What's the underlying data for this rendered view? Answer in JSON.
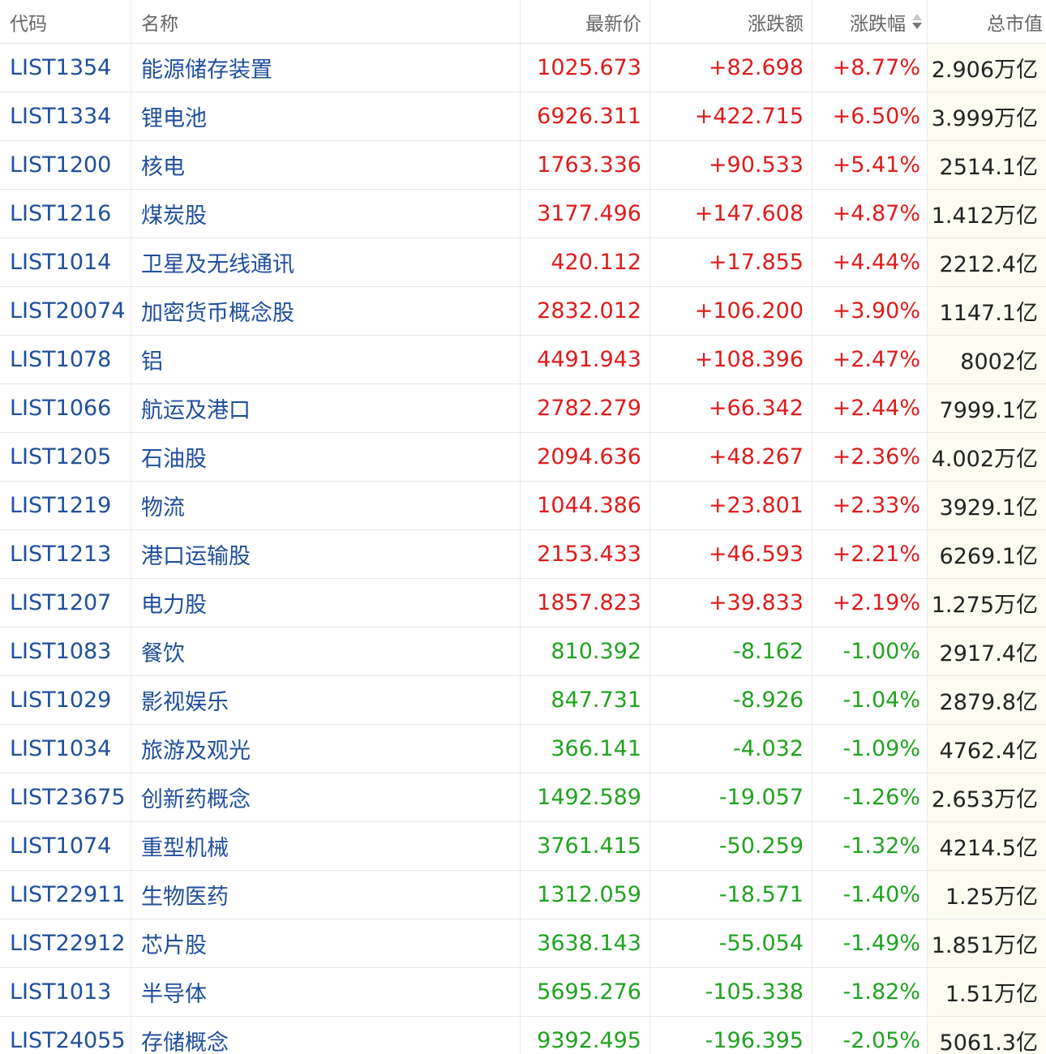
{
  "header": {
    "code": "代码",
    "name": "名称",
    "price": "最新价",
    "change": "涨跌额",
    "pct": "涨跌幅",
    "cap": "总市值"
  },
  "colors": {
    "up": "#e01b1b",
    "down": "#1fa31f",
    "link": "#1f4f9c"
  },
  "rows": [
    {
      "code": "LIST1354",
      "name": "能源储存装置",
      "price": "1025.673",
      "change": "+82.698",
      "pct": "+8.77%",
      "cap": "2.906万亿",
      "dir": "up"
    },
    {
      "code": "LIST1334",
      "name": "锂电池",
      "price": "6926.311",
      "change": "+422.715",
      "pct": "+6.50%",
      "cap": "3.999万亿",
      "dir": "up"
    },
    {
      "code": "LIST1200",
      "name": "核电",
      "price": "1763.336",
      "change": "+90.533",
      "pct": "+5.41%",
      "cap": "2514.1亿",
      "dir": "up"
    },
    {
      "code": "LIST1216",
      "name": "煤炭股",
      "price": "3177.496",
      "change": "+147.608",
      "pct": "+4.87%",
      "cap": "1.412万亿",
      "dir": "up"
    },
    {
      "code": "LIST1014",
      "name": "卫星及无线通讯",
      "price": "420.112",
      "change": "+17.855",
      "pct": "+4.44%",
      "cap": "2212.4亿",
      "dir": "up"
    },
    {
      "code": "LIST20074",
      "name": "加密货币概念股",
      "price": "2832.012",
      "change": "+106.200",
      "pct": "+3.90%",
      "cap": "1147.1亿",
      "dir": "up"
    },
    {
      "code": "LIST1078",
      "name": "铝",
      "price": "4491.943",
      "change": "+108.396",
      "pct": "+2.47%",
      "cap": "8002亿",
      "dir": "up"
    },
    {
      "code": "LIST1066",
      "name": "航运及港口",
      "price": "2782.279",
      "change": "+66.342",
      "pct": "+2.44%",
      "cap": "7999.1亿",
      "dir": "up"
    },
    {
      "code": "LIST1205",
      "name": "石油股",
      "price": "2094.636",
      "change": "+48.267",
      "pct": "+2.36%",
      "cap": "4.002万亿",
      "dir": "up"
    },
    {
      "code": "LIST1219",
      "name": "物流",
      "price": "1044.386",
      "change": "+23.801",
      "pct": "+2.33%",
      "cap": "3929.1亿",
      "dir": "up"
    },
    {
      "code": "LIST1213",
      "name": "港口运输股",
      "price": "2153.433",
      "change": "+46.593",
      "pct": "+2.21%",
      "cap": "6269.1亿",
      "dir": "up"
    },
    {
      "code": "LIST1207",
      "name": "电力股",
      "price": "1857.823",
      "change": "+39.833",
      "pct": "+2.19%",
      "cap": "1.275万亿",
      "dir": "up"
    },
    {
      "code": "LIST1083",
      "name": "餐饮",
      "price": "810.392",
      "change": "-8.162",
      "pct": "-1.00%",
      "cap": "2917.4亿",
      "dir": "down"
    },
    {
      "code": "LIST1029",
      "name": "影视娱乐",
      "price": "847.731",
      "change": "-8.926",
      "pct": "-1.04%",
      "cap": "2879.8亿",
      "dir": "down"
    },
    {
      "code": "LIST1034",
      "name": "旅游及观光",
      "price": "366.141",
      "change": "-4.032",
      "pct": "-1.09%",
      "cap": "4762.4亿",
      "dir": "down"
    },
    {
      "code": "LIST23675",
      "name": "创新药概念",
      "price": "1492.589",
      "change": "-19.057",
      "pct": "-1.26%",
      "cap": "2.653万亿",
      "dir": "down"
    },
    {
      "code": "LIST1074",
      "name": "重型机械",
      "price": "3761.415",
      "change": "-50.259",
      "pct": "-1.32%",
      "cap": "4214.5亿",
      "dir": "down"
    },
    {
      "code": "LIST22911",
      "name": "生物医药",
      "price": "1312.059",
      "change": "-18.571",
      "pct": "-1.40%",
      "cap": "1.25万亿",
      "dir": "down"
    },
    {
      "code": "LIST22912",
      "name": "芯片股",
      "price": "3638.143",
      "change": "-55.054",
      "pct": "-1.49%",
      "cap": "1.851万亿",
      "dir": "down"
    },
    {
      "code": "LIST1013",
      "name": "半导体",
      "price": "5695.276",
      "change": "-105.338",
      "pct": "-1.82%",
      "cap": "1.51万亿",
      "dir": "down"
    },
    {
      "code": "LIST24055",
      "name": "存储概念",
      "price": "9392.495",
      "change": "-196.395",
      "pct": "-2.05%",
      "cap": "5061.3亿",
      "dir": "down"
    }
  ]
}
